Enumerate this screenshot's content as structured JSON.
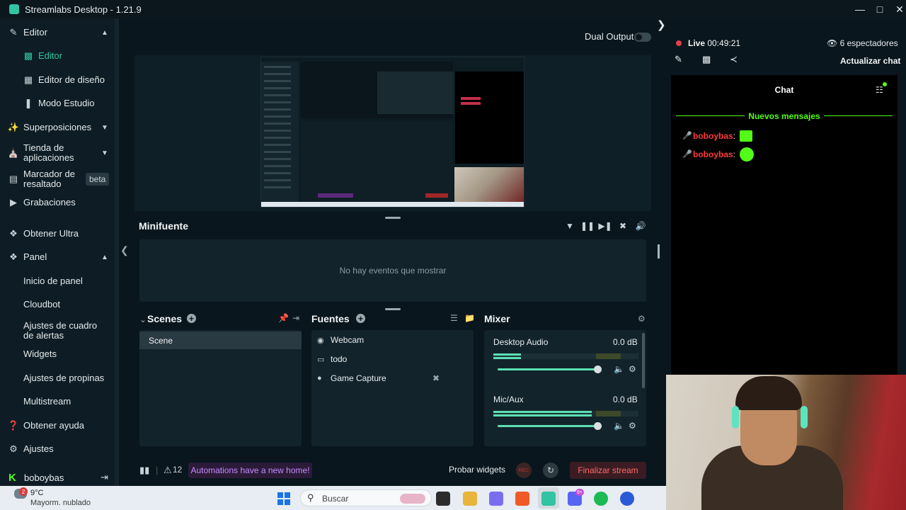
{
  "window": {
    "title": "Streamlabs Desktop - 1.21.9"
  },
  "sidebar": {
    "items": [
      {
        "label": "Editor",
        "icon": "brush-icon"
      },
      {
        "label": "Editor",
        "icon": "scenes-icon",
        "sub": true,
        "active": true
      },
      {
        "label": "Editor de diseño",
        "icon": "layout-icon",
        "sub": true
      },
      {
        "label": "Modo Estudio",
        "icon": "studio-icon",
        "sub": true
      },
      {
        "label": "Superposiciones",
        "icon": "themes-icon"
      },
      {
        "label": "Tienda de aplicaciones",
        "icon": "store-icon"
      },
      {
        "label": "Marcador de resaltado",
        "icon": "highlighter-icon",
        "badge": "beta"
      },
      {
        "label": "Grabaciones",
        "icon": "recordings-icon"
      },
      {
        "label": "Obtener Ultra",
        "icon": "ultra-icon"
      },
      {
        "label": "Panel",
        "icon": "dashboard-icon"
      },
      {
        "label": "Inicio de panel",
        "sub": true
      },
      {
        "label": "Cloudbot",
        "sub": true
      },
      {
        "label": "Ajustes de cuadro de alertas",
        "sub": true
      },
      {
        "label": "Widgets",
        "sub": true
      },
      {
        "label": "Ajustes de propinas",
        "sub": true
      },
      {
        "label": "Multistream",
        "sub": true
      },
      {
        "label": "Obtener ayuda",
        "icon": "help-icon"
      },
      {
        "label": "Ajustes",
        "icon": "settings-icon"
      }
    ],
    "user": {
      "name": "boboybas"
    }
  },
  "header": {
    "dual_output_label": "Dual Output",
    "dual_output_enabled": false
  },
  "minifuente": {
    "title": "Minifuente",
    "empty_text": "No hay eventos que mostrar"
  },
  "scenes": {
    "title": "Scenes",
    "items": [
      "Scene"
    ]
  },
  "sources": {
    "title": "Fuentes",
    "items": [
      {
        "label": "Webcam",
        "icon": "webcam-icon"
      },
      {
        "label": "todo",
        "icon": "monitor-icon"
      },
      {
        "label": "Game Capture",
        "icon": "gamepad-icon",
        "hidden": true
      }
    ]
  },
  "mixer": {
    "title": "Mixer",
    "channels": [
      {
        "name": "Desktop Audio",
        "db": "0.0 dB",
        "level": 0.19,
        "volume": 1.0
      },
      {
        "name": "Mic/Aux",
        "db": "0.0 dB",
        "level": 0.68,
        "volume": 1.0
      }
    ]
  },
  "footer": {
    "alerts_count": "12",
    "automations_label": "Automations have a new home!",
    "test_widgets_label": "Probar widgets",
    "rec_label": "REC",
    "end_stream_label": "Finalizar stream"
  },
  "stream": {
    "live_label": "Live",
    "live_time": "00:49:21",
    "viewers": "6 espectadores",
    "refresh_chat": "Actualizar chat"
  },
  "chat": {
    "title": "Chat",
    "new_messages": "Nuevos mensajes",
    "messages": [
      {
        "user": "boboybas",
        "emote": "angry-emote"
      },
      {
        "user": "boboybas",
        "emote": "happy-emote"
      }
    ]
  },
  "taskbar": {
    "weather_temp": "9°C",
    "weather_cond": "Mayorm. nublado",
    "weather_badge": "2",
    "search_placeholder": "Buscar",
    "discord_badge": "9+"
  },
  "colors": {
    "accent": "#31c3a2",
    "kick_green": "#53fc18",
    "live_red": "#e0414b",
    "end_stream": "#ff6b6b"
  }
}
